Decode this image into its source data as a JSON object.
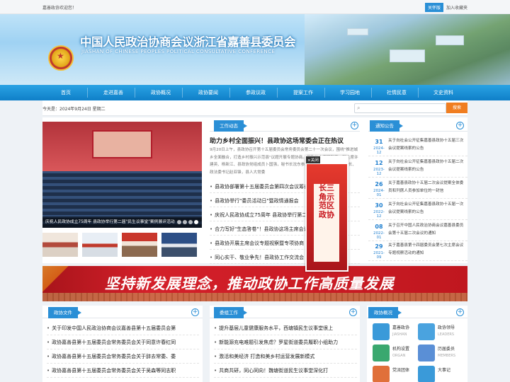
{
  "topbar": {
    "welcome": "嘉善政协欢迎您！",
    "care_mode": "关怀版",
    "favorite": "加入收藏夹"
  },
  "header": {
    "title": "中国人民政治协商会议浙江省嘉善县委员会",
    "subtitle": "JIASHAN OF CHINESE PEOPLES POLITICAL CONSULTATIVE CONFERENCE"
  },
  "nav": {
    "items": [
      "首页",
      "走进嘉善",
      "政协概况",
      "政协要闻",
      "参政议政",
      "提案工作",
      "学习园地",
      "社情民意",
      "文史资料"
    ]
  },
  "datebar": {
    "date": "今天是：2024年9月24日 星期二",
    "search_button": "搜索",
    "search_placeholder": ""
  },
  "slider": {
    "caption": "庆祝人民政协成立75周年 县政协举行第二届\"民生议事堂\"案例展评活动"
  },
  "work_news": {
    "tag": "工作动态",
    "headline": "助力乡村全面振兴！县政协这场常委会正在热议",
    "summary": "9月20日上午，县政协召开第十五届委员会常务委员会第二十一次会议，围绕\"推进城乡全面融合，打造乡村振兴示范县\"议题开展专题协商。县政协主席顾新宇，副主席许建英、杨新江、县政协党组成员卜国强，秘书长沈东参加。县委副书记、社工部长、政法委书记赵亚锋，县人大常委",
    "items": [
      "县政协部署第十五届委员会第四次会议筹备工作",
      "县政协举行\"委员活动日\"暨政情通报会",
      "庆祝人民政协成立75周年 县政协举行第二届\"民生议事堂\"",
      "合力写好\"生态答卷\"！县政协这场主席会议",
      "县政协开展主席会议专题视察暨专项协商",
      "同心实干、敬业争先！县政协工作交流会"
    ]
  },
  "popup": {
    "close_label": "×关闭",
    "text": "长三角示范区政协"
  },
  "notices": {
    "tag": "通知公告",
    "items": [
      {
        "day": "31",
        "month": "2024-12",
        "title": "关于向社会公开征集嘉善县政协十五届三次会议提案线索的公告"
      },
      {
        "day": "12",
        "month": "2023-12",
        "title": "关于向社会公开征集嘉善县政协十五届二次会议提案线索的公告"
      },
      {
        "day": "26",
        "month": "2024-01",
        "title": "关于嘉善县政协十五届二次会议提案全体委员和列席人员参加单位的一封信"
      },
      {
        "day": "30",
        "month": "2022-12",
        "title": "关于向社会公开征集嘉善县政协十五届一次会议提案线索的公告"
      },
      {
        "day": "08",
        "month": "2022-01",
        "title": "关于召开中国人民政治协商会议嘉善县委员会第十五届二次会议的通知"
      },
      {
        "day": "29",
        "month": "2021-09",
        "title": "关于嘉善县第十四届委员会第七次主席会议专题视察活动的通知"
      }
    ]
  },
  "banner_wide": {
    "text": "坚持新发展理念，推动政协工作高质量发展"
  },
  "docs": {
    "tag": "政协文件",
    "items": [
      "关于印发中国人民政治协商会议嘉善县第十五届委员会第",
      "政协嘉善县第十五届委员会常务委员会关于同意许春红同",
      "政协嘉善县第十五届委员会常务委员会关于辞去常委、委",
      "政协嘉善县第十五届委员会常务委员会关于吴森等同志职",
      "政协嘉善县第十五届委员会常务委员会关于同意辞去有关"
    ]
  },
  "committee": {
    "tag": "委组工作",
    "items": [
      "提升基层儿童健康服务水平，西塘镇民生议事堂很上",
      "新能源充电难题引发焦虑？罗星街道委员履职小组助力",
      "激活和美经济 打造和美乡村运营发展新模式",
      "共商共研，同心同向！魏塘街道民生议事堂深化打",
      "打造\"幸福乐园\" 惠民议事大家谈"
    ]
  },
  "overview": {
    "tag": "政协概况",
    "items": [
      {
        "label": "嘉善政协",
        "sub": "JIASHAN",
        "icon": "building-icon",
        "color": "#3a9ad9"
      },
      {
        "label": "政协领导",
        "sub": "LEADERS",
        "icon": "people-icon",
        "color": "#4aa3df"
      },
      {
        "label": "机构设置",
        "sub": "ORGAN",
        "icon": "org-icon",
        "color": "#3aa86f"
      },
      {
        "label": "历届委员",
        "sub": "MEMBERS",
        "icon": "member-icon",
        "color": "#5a8fd6"
      },
      {
        "label": "党派团体",
        "sub": "PARTIES",
        "icon": "party-icon",
        "color": "#e0703a"
      },
      {
        "label": "大事记",
        "sub": "EVENTS",
        "icon": "calendar-icon",
        "color": "#3a9ad9"
      }
    ]
  }
}
